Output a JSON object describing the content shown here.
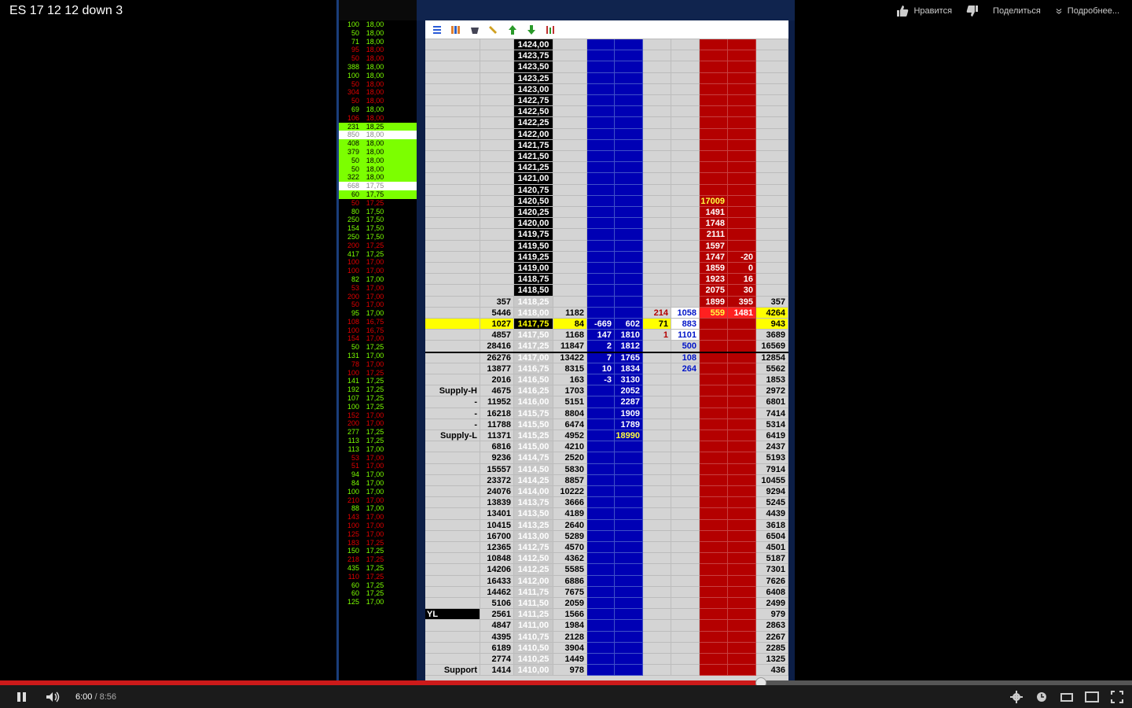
{
  "video": {
    "title": "ES 17 12 12 down 3",
    "actions": {
      "like": "Нравится",
      "share": "Поделиться",
      "more": "Подробнее..."
    },
    "current_time": "6:00",
    "duration": "8:56",
    "progress_fraction": 0.672
  },
  "time_and_sales": [
    [
      "100",
      "18,00",
      "g"
    ],
    [
      "50",
      "18,00",
      "g"
    ],
    [
      "71",
      "18,00",
      "g"
    ],
    [
      "95",
      "18,00",
      "r"
    ],
    [
      "50",
      "18,00",
      "r"
    ],
    [
      "388",
      "18,00",
      "g"
    ],
    [
      "100",
      "18,00",
      "g"
    ],
    [
      "50",
      "18,00",
      "r"
    ],
    [
      "304",
      "18,00",
      "r"
    ],
    [
      "50",
      "18,00",
      "r"
    ],
    [
      "69",
      "18,00",
      "g"
    ],
    [
      "106",
      "18,00",
      "r"
    ],
    [
      "231",
      "18,25",
      "hl"
    ],
    [
      "850",
      "18,00",
      "wh"
    ],
    [
      "408",
      "18,00",
      "hl"
    ],
    [
      "379",
      "18,00",
      "hl"
    ],
    [
      "50",
      "18,00",
      "hl"
    ],
    [
      "50",
      "18,00",
      "hl"
    ],
    [
      "322",
      "18,00",
      "hl"
    ],
    [
      "668",
      "17,75",
      "wh"
    ],
    [
      "60",
      "17,75",
      "hl"
    ],
    [
      "50",
      "17,25",
      "r"
    ],
    [
      "80",
      "17,50",
      "g"
    ],
    [
      "250",
      "17,50",
      "g"
    ],
    [
      "154",
      "17,50",
      "g"
    ],
    [
      "250",
      "17,50",
      "g"
    ],
    [
      "200",
      "17,25",
      "r"
    ],
    [
      "417",
      "17,25",
      "g"
    ],
    [
      "100",
      "17,00",
      "r"
    ],
    [
      "100",
      "17,00",
      "r"
    ],
    [
      "82",
      "17,00",
      "g"
    ],
    [
      "53",
      "17,00",
      "r"
    ],
    [
      "200",
      "17,00",
      "r"
    ],
    [
      "50",
      "17,00",
      "r"
    ],
    [
      "95",
      "17,00",
      "g"
    ],
    [
      "108",
      "16,75",
      "r"
    ],
    [
      "100",
      "16,75",
      "r"
    ],
    [
      "154",
      "17,00",
      "r"
    ],
    [
      "50",
      "17,25",
      "g"
    ],
    [
      "131",
      "17,00",
      "g"
    ],
    [
      "78",
      "17,00",
      "r"
    ],
    [
      "100",
      "17,25",
      "r"
    ],
    [
      "141",
      "17,25",
      "g"
    ],
    [
      "192",
      "17,25",
      "g"
    ],
    [
      "107",
      "17,25",
      "g"
    ],
    [
      "100",
      "17,25",
      "g"
    ],
    [
      "152",
      "17,00",
      "r"
    ],
    [
      "200",
      "17,00",
      "r"
    ],
    [
      "277",
      "17,25",
      "g"
    ],
    [
      "113",
      "17,25",
      "g"
    ],
    [
      "113",
      "17,00",
      "g"
    ],
    [
      "53",
      "17,00",
      "r"
    ],
    [
      "51",
      "17,00",
      "r"
    ],
    [
      "94",
      "17,00",
      "g"
    ],
    [
      "84",
      "17,00",
      "g"
    ],
    [
      "100",
      "17,00",
      "g"
    ],
    [
      "210",
      "17,00",
      "r"
    ],
    [
      "88",
      "17,00",
      "g"
    ],
    [
      "143",
      "17,00",
      "r"
    ],
    [
      "100",
      "17,00",
      "r"
    ],
    [
      "125",
      "17,00",
      "r"
    ],
    [
      "183",
      "17,25",
      "r"
    ],
    [
      "150",
      "17,25",
      "g"
    ],
    [
      "218",
      "17,25",
      "r"
    ],
    [
      "435",
      "17,25",
      "g"
    ],
    [
      "110",
      "17,25",
      "r"
    ],
    [
      "60",
      "17,25",
      "g"
    ],
    [
      "60",
      "17,25",
      "g"
    ],
    [
      "125",
      "17,00",
      "g"
    ]
  ],
  "ladder": [
    {
      "c2": "1424,00"
    },
    {
      "c2": "1423,75"
    },
    {
      "c2": "1423,50"
    },
    {
      "c2": "1423,25"
    },
    {
      "c2": "1423,00"
    },
    {
      "c2": "1422,75"
    },
    {
      "c2": "1422,50"
    },
    {
      "c2": "1422,25"
    },
    {
      "c2": "1422,00"
    },
    {
      "c2": "1421,75"
    },
    {
      "c2": "1421,50"
    },
    {
      "c2": "1421,25"
    },
    {
      "c2": "1421,00"
    },
    {
      "c2": "1420,75"
    },
    {
      "c2": "1420,50",
      "c8": "17009",
      "c8y": true
    },
    {
      "c2": "1420,25",
      "c8": "1491"
    },
    {
      "c2": "1420,00",
      "c8": "1748"
    },
    {
      "c2": "1419,75",
      "c8": "2111"
    },
    {
      "c2": "1419,50",
      "c8": "1597"
    },
    {
      "c2": "1419,25",
      "c8": "1747",
      "c9": "-20"
    },
    {
      "c2": "1419,00",
      "c8": "1859",
      "c9": "0"
    },
    {
      "c2": "1418,75",
      "c8": "1923",
      "c9": "16"
    },
    {
      "c2": "1418,50",
      "c8": "2075",
      "c9": "30"
    },
    {
      "c1": "357",
      "c2": "1418,25",
      "c8": "1899",
      "c9": "395",
      "c10": "357",
      "cls": "best"
    },
    {
      "c1": "5446",
      "c2": "1418,00",
      "c3": "1182",
      "c6": "214",
      "c7": "1058",
      "c8": "559",
      "c9": "1481",
      "c10": "4264",
      "cls": "best ask"
    },
    {
      "c1": "1027",
      "c2": "1417,75",
      "c3": "84",
      "c4": "-669",
      "c5": "602",
      "c6": "71",
      "c7": "883",
      "c10": "943",
      "cls": "cur"
    },
    {
      "c1": "4857",
      "c2": "1417,50",
      "c3": "1168",
      "c4": "147",
      "c5": "1810",
      "c6": "1",
      "c7": "1101",
      "c10": "3689",
      "cls": "best bid1"
    },
    {
      "c1": "28416",
      "c2": "1417,25",
      "c3": "11847",
      "c4": "2",
      "c5": "1812",
      "c7": "500",
      "c10": "16569",
      "cls": "best bidblue"
    },
    {
      "c1": "26276",
      "c2": "1417,00",
      "c3": "13422",
      "c4": "7",
      "c5": "1765",
      "c7": "108",
      "c10": "12854",
      "cls": "best bidblue"
    },
    {
      "c1": "13877",
      "c2": "1416,75",
      "c3": "8315",
      "c4": "10",
      "c5": "1834",
      "c7": "264",
      "c10": "5562",
      "cls": "best bidblue"
    },
    {
      "c1": "2016",
      "c2": "1416,50",
      "c3": "163",
      "c4": "-3",
      "c5": "3130",
      "c10": "1853",
      "cls": "best"
    },
    {
      "c0": "Supply-H",
      "c1": "4675",
      "c2": "1416,25",
      "c3": "1703",
      "c5": "2052",
      "c10": "2972",
      "cls": "best"
    },
    {
      "c0": "-",
      "c1": "11952",
      "c2": "1416,00",
      "c3": "5151",
      "c5": "2287",
      "c10": "6801",
      "cls": "best"
    },
    {
      "c0": "-",
      "c1": "16218",
      "c2": "1415,75",
      "c3": "8804",
      "c5": "1909",
      "c10": "7414",
      "cls": "best"
    },
    {
      "c0": "-",
      "c1": "11788",
      "c2": "1415,50",
      "c3": "6474",
      "c5": "1789",
      "c10": "5314",
      "cls": "best"
    },
    {
      "c0": "Supply-L",
      "c1": "11371",
      "c2": "1415,25",
      "c3": "4952",
      "c5": "18990",
      "c5y": true,
      "c10": "6419",
      "cls": "best"
    },
    {
      "c1": "6816",
      "c2": "1415,00",
      "c3": "4210",
      "c10": "2437",
      "cls": "best"
    },
    {
      "c1": "9236",
      "c2": "1414,75",
      "c3": "2520",
      "c10": "5193",
      "cls": "best"
    },
    {
      "c1": "15557",
      "c2": "1414,50",
      "c3": "5830",
      "c10": "7914",
      "cls": "best"
    },
    {
      "c1": "23372",
      "c2": "1414,25",
      "c3": "8857",
      "c10": "10455",
      "cls": "best"
    },
    {
      "c1": "24076",
      "c2": "1414,00",
      "c3": "10222",
      "c10": "9294",
      "cls": "best"
    },
    {
      "c1": "13839",
      "c2": "1413,75",
      "c3": "3666",
      "c10": "5245",
      "cls": "best"
    },
    {
      "c1": "13401",
      "c2": "1413,50",
      "c3": "4189",
      "c10": "4439",
      "cls": "best"
    },
    {
      "c1": "10415",
      "c2": "1413,25",
      "c3": "2640",
      "c10": "3618",
      "cls": "best"
    },
    {
      "c1": "16700",
      "c2": "1413,00",
      "c3": "5289",
      "c10": "6504",
      "cls": "best"
    },
    {
      "c1": "12365",
      "c2": "1412,75",
      "c3": "4570",
      "c10": "4501",
      "cls": "best"
    },
    {
      "c1": "10848",
      "c2": "1412,50",
      "c3": "4362",
      "c10": "5187",
      "cls": "best"
    },
    {
      "c1": "14206",
      "c2": "1412,25",
      "c3": "5585",
      "c10": "7301",
      "cls": "best"
    },
    {
      "c1": "16433",
      "c2": "1412,00",
      "c3": "6886",
      "c10": "7626",
      "cls": "best"
    },
    {
      "c1": "14462",
      "c2": "1411,75",
      "c3": "7675",
      "c10": "6408",
      "cls": "best"
    },
    {
      "c1": "5106",
      "c2": "1411,50",
      "c3": "2059",
      "c10": "2499",
      "cls": "best"
    },
    {
      "c0": "YL",
      "c0yl": true,
      "c1": "2561",
      "c2": "1411,25",
      "c3": "1566",
      "c10": "979",
      "cls": "best"
    },
    {
      "c1": "4847",
      "c2": "1411,00",
      "c3": "1984",
      "c10": "2863",
      "cls": "best"
    },
    {
      "c1": "4395",
      "c2": "1410,75",
      "c3": "2128",
      "c10": "2267",
      "cls": "best"
    },
    {
      "c1": "6189",
      "c2": "1410,50",
      "c3": "3904",
      "c10": "2285",
      "cls": "best"
    },
    {
      "c1": "2774",
      "c2": "1410,25",
      "c3": "1449",
      "c10": "1325",
      "cls": "best"
    },
    {
      "c0": "Support",
      "c1": "1414",
      "c2": "1410,00",
      "c3": "978",
      "c10": "436",
      "cls": "best"
    }
  ],
  "colors": {
    "bid_column": "#0000b4",
    "ask_column": "#b40000",
    "current_row": "#ffff00",
    "buy_print": "#7cff00",
    "sell_print": "#e00000",
    "progress": "#cc1a1a"
  },
  "icons": [
    "thumbs-up-icon",
    "thumbs-down-icon",
    "more-chevron-icon",
    "pause-icon",
    "volume-icon",
    "settings-icon",
    "watch-later-icon",
    "small-player-icon",
    "large-player-icon",
    "fullscreen-icon"
  ]
}
